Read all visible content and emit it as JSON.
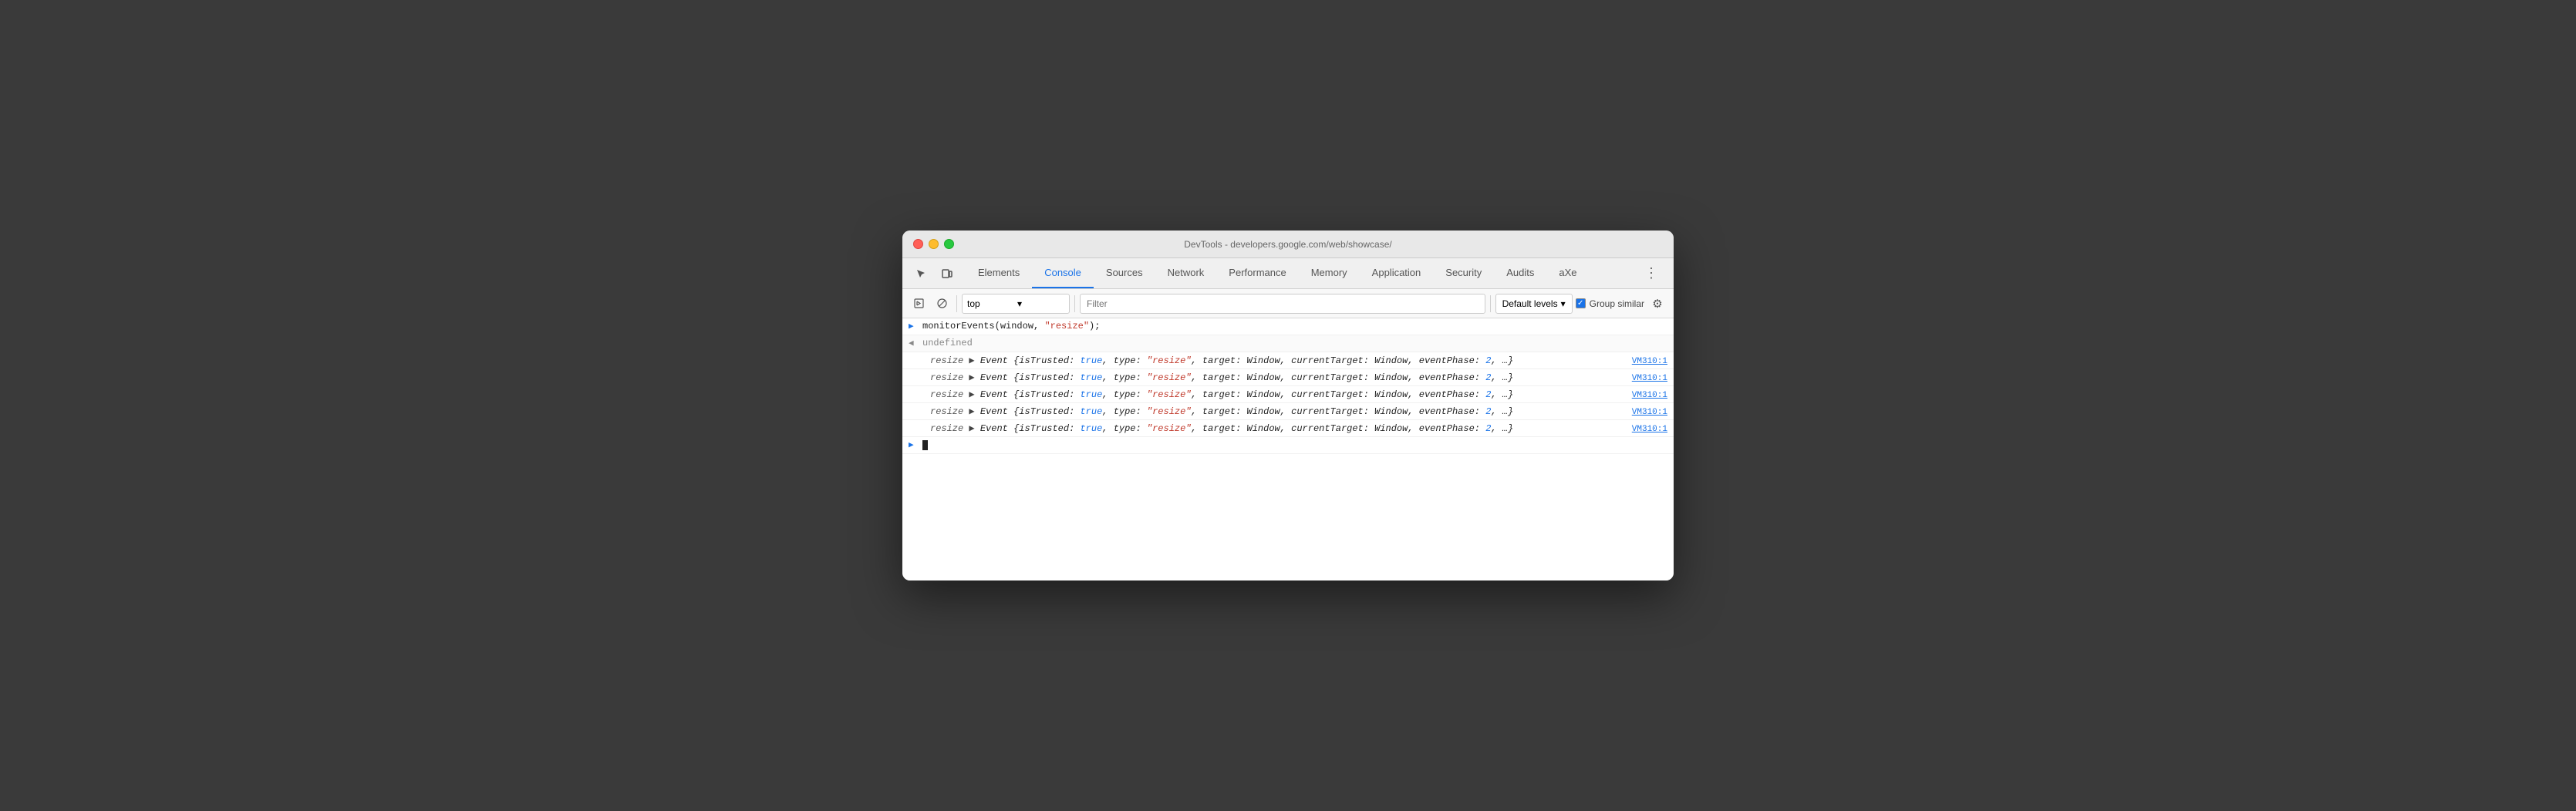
{
  "window": {
    "title": "DevTools - developers.google.com/web/showcase/"
  },
  "traffic_lights": {
    "red": "red",
    "yellow": "yellow",
    "green": "green"
  },
  "tabs": [
    {
      "id": "elements",
      "label": "Elements",
      "active": false
    },
    {
      "id": "console",
      "label": "Console",
      "active": true
    },
    {
      "id": "sources",
      "label": "Sources",
      "active": false
    },
    {
      "id": "network",
      "label": "Network",
      "active": false
    },
    {
      "id": "performance",
      "label": "Performance",
      "active": false
    },
    {
      "id": "memory",
      "label": "Memory",
      "active": false
    },
    {
      "id": "application",
      "label": "Application",
      "active": false
    },
    {
      "id": "security",
      "label": "Security",
      "active": false
    },
    {
      "id": "audits",
      "label": "Audits",
      "active": false
    },
    {
      "id": "axe",
      "label": "aXe",
      "active": false
    }
  ],
  "toolbar": {
    "context_value": "top",
    "context_arrow": "▾",
    "filter_placeholder": "Filter",
    "levels_label": "Default levels",
    "levels_arrow": "▾",
    "group_similar_label": "Group similar",
    "settings_icon": "⚙"
  },
  "console": {
    "command_line": "monitorEvents(window, \"resize\");",
    "result_line": "undefined",
    "event_label": "resize",
    "event_content": "Event {isTrusted: true, type: \"resize\", target: Window, currentTarget: Window, eventPhase: 2, …}",
    "source_ref": "VM310:1",
    "rows": [
      {
        "type": "command",
        "icon": "▶",
        "icon_type": "right",
        "text_prefix": "",
        "code": "monitorEvents(window, \"resize\");"
      },
      {
        "type": "result",
        "icon": "◀",
        "icon_type": "left",
        "text": "undefined"
      },
      {
        "type": "event",
        "label": "resize",
        "content": "Event {isTrusted: true, type: \"resize\", target: Window, currentTarget: Window, eventPhase: 2, …}",
        "source": "VM310:1"
      },
      {
        "type": "event",
        "label": "resize",
        "content": "Event {isTrusted: true, type: \"resize\", target: Window, currentTarget: Window, eventPhase: 2, …}",
        "source": "VM310:1"
      },
      {
        "type": "event",
        "label": "resize",
        "content": "Event {isTrusted: true, type: \"resize\", target: Window, currentTarget: Window, eventPhase: 2, …}",
        "source": "VM310:1"
      },
      {
        "type": "event",
        "label": "resize",
        "content": "Event {isTrusted: true, type: \"resize\", target: Window, currentTarget: Window, eventPhase: 2, …}",
        "source": "VM310:1"
      },
      {
        "type": "event",
        "label": "resize",
        "content": "Event {isTrusted: true, type: \"resize\", target: Window, currentTarget: Window, eventPhase: 2, …}",
        "source": "VM310:1"
      }
    ]
  }
}
